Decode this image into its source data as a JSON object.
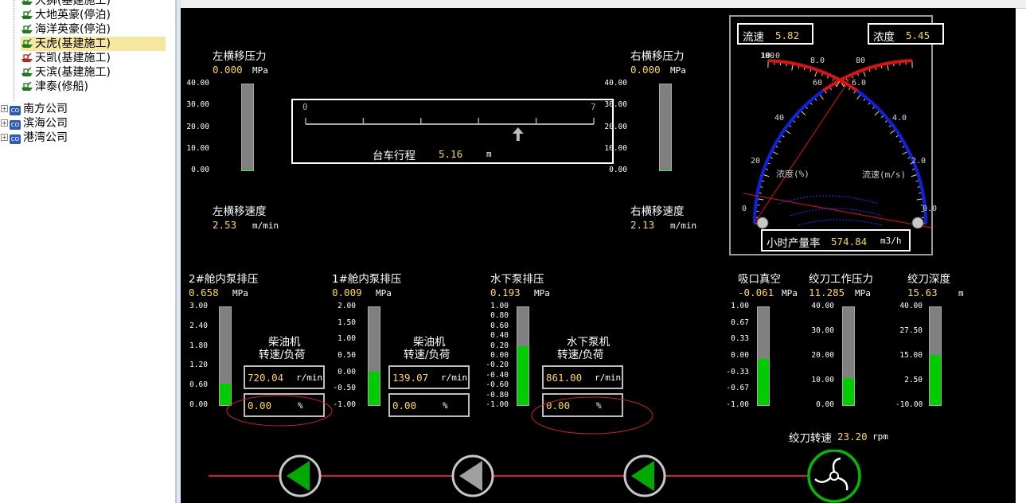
{
  "tree": {
    "items": [
      {
        "label": "大狮(基建施工)",
        "status": "building"
      },
      {
        "label": "大地英豪(停泊)",
        "status": "moored"
      },
      {
        "label": "海洋英豪(停泊)",
        "status": "moored"
      },
      {
        "label": "天虎(基建施工)",
        "status": "building",
        "selected": true
      },
      {
        "label": "天凯(基建施工)",
        "status": "building"
      },
      {
        "label": "天滨(基建施工)",
        "status": "building"
      },
      {
        "label": "津泰(修船)",
        "status": "repair"
      }
    ],
    "companies": [
      {
        "label": "南方公司",
        "icon": "CO"
      },
      {
        "label": "滨海公司",
        "icon": "CO"
      },
      {
        "label": "港湾公司",
        "icon": "CO"
      }
    ]
  },
  "left_traverse": {
    "pressure_label": "左横移压力",
    "pressure_value": "0.000",
    "pressure_unit": "MPa",
    "ticks": [
      "40.00",
      "30.00",
      "20.00",
      "10.00",
      "0.00"
    ],
    "fill_fraction": 0.0,
    "speed_label": "左横移速度",
    "speed_value": "2.53",
    "speed_unit": "m/min"
  },
  "right_traverse": {
    "pressure_label": "右横移压力",
    "pressure_value": "0.000",
    "pressure_unit": "MPa",
    "ticks": [
      "40.00",
      "30.00",
      "20.00",
      "10.00",
      "0.00"
    ],
    "fill_fraction": 0.0,
    "speed_label": "右横移速度",
    "speed_value": "2.13",
    "speed_unit": "m/min"
  },
  "trolley": {
    "label": "台车行程",
    "value": "5.16",
    "unit": "m",
    "scale_min": "0",
    "scale_max": "7",
    "position": 5.16
  },
  "gauge": {
    "flow_label": "流速",
    "flow_value": "5.82",
    "density_label": "浓度",
    "density_value": "5.45",
    "left_scale": [
      "100",
      "80",
      "60",
      "40",
      "20",
      "0"
    ],
    "right_scale": [
      "10.0",
      "8.0",
      "6.0",
      "4.0",
      "2.0",
      "0.0"
    ],
    "density_axis": "浓度(%)",
    "flow_axis": "流速(m/s)",
    "production_label": "小时产量率",
    "production_value": "574.84",
    "production_unit": "m3/h",
    "colors": {
      "red": "#e01010",
      "blue": "#1020e0"
    }
  },
  "pumps": {
    "pump2": {
      "label": "2#舱内泵排压",
      "value": "0.658",
      "unit": "MPa",
      "ticks": [
        "3.00",
        "2.40",
        "1.80",
        "1.20",
        "0.60",
        "0.00"
      ],
      "fill_fraction": 0.22,
      "engine_label1": "柴油机",
      "engine_label2": "转速/负荷",
      "rpm_value": "720.04",
      "rpm_unit": "r/min",
      "load_value": "0.00",
      "load_unit": "%"
    },
    "pump1": {
      "label": "1#舱内泵排压",
      "value": "0.009",
      "unit": "MPa",
      "ticks": [
        "2.00",
        "1.50",
        "1.00",
        "0.50",
        "0.00",
        "-0.50",
        "-1.00"
      ],
      "fill_fraction": 0.34,
      "engine_label1": "柴油机",
      "engine_label2": "转速/负荷",
      "rpm_value": "139.07",
      "rpm_unit": "r/min",
      "load_value": "0.00",
      "load_unit": "%"
    },
    "underwater": {
      "label": "水下泵排压",
      "value": "0.193",
      "unit": "MPa",
      "ticks": [
        "1.00",
        "0.80",
        "0.60",
        "0.40",
        "0.20",
        "0.00",
        "-0.20",
        "-0.40",
        "-0.60",
        "-0.80",
        "-1.00"
      ],
      "fill_fraction": 0.6,
      "engine_label1": "水下泵机",
      "engine_label2": "转速/负荷",
      "rpm_value": "861.00",
      "rpm_unit": "r/min",
      "load_value": "0.00",
      "load_unit": "%"
    }
  },
  "suction": {
    "label": "吸口真空",
    "value": "-0.061",
    "unit": "MPa",
    "ticks": [
      "1.00",
      "0.67",
      "0.33",
      "0.00",
      "-0.33",
      "-0.67",
      "-1.00"
    ],
    "fill_fraction": 0.47
  },
  "cutter_pressure": {
    "label": "绞刀工作压力",
    "value": "11.285",
    "unit": "MPa",
    "ticks": [
      "40.00",
      "30.00",
      "20.00",
      "10.00",
      "0.00"
    ],
    "fill_fraction": 0.28
  },
  "cutter_depth": {
    "label": "绞刀深度",
    "value": "15.63",
    "unit": "m",
    "ticks": [
      "40.00",
      "27.50",
      "15.00",
      "2.50",
      "-10.00"
    ],
    "fill_fraction": 0.51
  },
  "cutter_speed": {
    "label": "绞刀转速",
    "value": "23.20",
    "unit": "rpm"
  }
}
